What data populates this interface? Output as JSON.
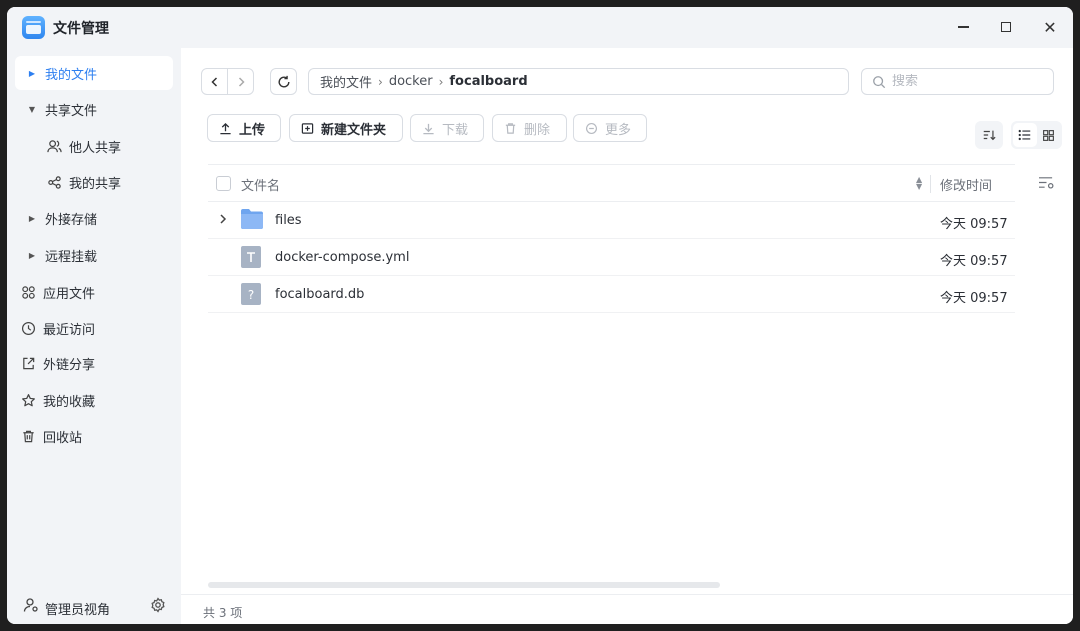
{
  "window": {
    "title": "文件管理"
  },
  "sidebar": {
    "items": [
      {
        "label": "我的文件",
        "icon": "caret-right-icon",
        "active": true
      },
      {
        "label": "共享文件",
        "icon": "caret-down-icon"
      },
      {
        "label": "他人共享",
        "icon": "people-icon"
      },
      {
        "label": "我的共享",
        "icon": "share-nodes-icon"
      },
      {
        "label": "外接存储",
        "icon": "caret-right-icon"
      },
      {
        "label": "远程挂载",
        "icon": "caret-right-icon"
      },
      {
        "label": "应用文件",
        "icon": "apps-grid-icon"
      },
      {
        "label": "最近访问",
        "icon": "clock-icon"
      },
      {
        "label": "外链分享",
        "icon": "external-link-icon"
      },
      {
        "label": "我的收藏",
        "icon": "star-icon"
      },
      {
        "label": "回收站",
        "icon": "trash-icon"
      }
    ],
    "footer": {
      "label": "管理员视角"
    }
  },
  "path": {
    "crumbs": [
      "我的文件",
      "docker",
      "focalboard"
    ]
  },
  "search": {
    "placeholder": "搜索"
  },
  "toolbar": {
    "upload": "上传",
    "new_folder": "新建文件夹",
    "download": "下载",
    "delete": "删除",
    "more": "更多"
  },
  "table": {
    "columns": {
      "name": "文件名",
      "modified": "修改时间"
    },
    "rows": [
      {
        "name": "files",
        "modified": "今天 09:57",
        "type": "folder"
      },
      {
        "name": "docker-compose.yml",
        "modified": "今天 09:57",
        "type": "text"
      },
      {
        "name": "focalboard.db",
        "modified": "今天 09:57",
        "type": "unknown"
      }
    ]
  },
  "status": {
    "count": "共 3 项"
  },
  "colors": {
    "accent": "#2d7ff0",
    "sidebar_bg": "#f2f4f7",
    "folder": "#8db8f5"
  }
}
